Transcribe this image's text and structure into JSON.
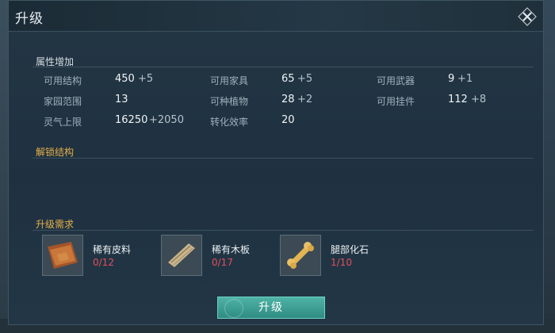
{
  "dialog": {
    "title": "升级"
  },
  "sections": {
    "attributes": "属性增加",
    "unlock": "解锁结构",
    "requirements": "升级需求"
  },
  "stats": [
    {
      "label": "可用结构",
      "value": "450",
      "bonus": "+5"
    },
    {
      "label": "可用家具",
      "value": "65",
      "bonus": "+5"
    },
    {
      "label": "可用武器",
      "value": "9",
      "bonus": "+1"
    },
    {
      "label": "家园范围",
      "value": "13",
      "bonus": ""
    },
    {
      "label": "可种植物",
      "value": "28",
      "bonus": "+2"
    },
    {
      "label": "可用挂件",
      "value": "112",
      "bonus": "+8"
    },
    {
      "label": "灵气上限",
      "value": "16250",
      "bonus": "+2050"
    },
    {
      "label": "转化效率",
      "value": "20",
      "bonus": ""
    }
  ],
  "materials": [
    {
      "name": "稀有皮料",
      "count": "0/12",
      "icon": "leather-icon"
    },
    {
      "name": "稀有木板",
      "count": "0/17",
      "icon": "wood-plank-icon"
    },
    {
      "name": "腿部化石",
      "count": "1/10",
      "icon": "bone-fossil-icon"
    }
  ],
  "actions": {
    "upgrade_label": "升级"
  },
  "colors": {
    "accent_gold": "#e5b04a",
    "count_red": "#e2505a",
    "button_teal": "#3a9c91"
  }
}
